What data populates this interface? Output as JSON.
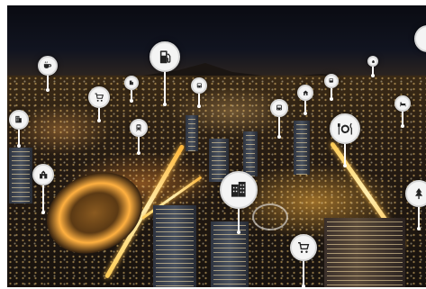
{
  "scene": {
    "description_icons": [
      "coffee-cup-icon",
      "shopping-cart-icon",
      "building-icon",
      "fuel-pump-icon",
      "bus-icon",
      "school-icon",
      "train-icon",
      "plate-cutlery-icon",
      "hotel-icon",
      "tree-icon",
      "house-icon"
    ],
    "colors": {
      "sky": "#0a0b12",
      "city_glow": "#ffb040",
      "pin_fill": "#f4f4f4",
      "icon_dark": "#222222"
    }
  }
}
